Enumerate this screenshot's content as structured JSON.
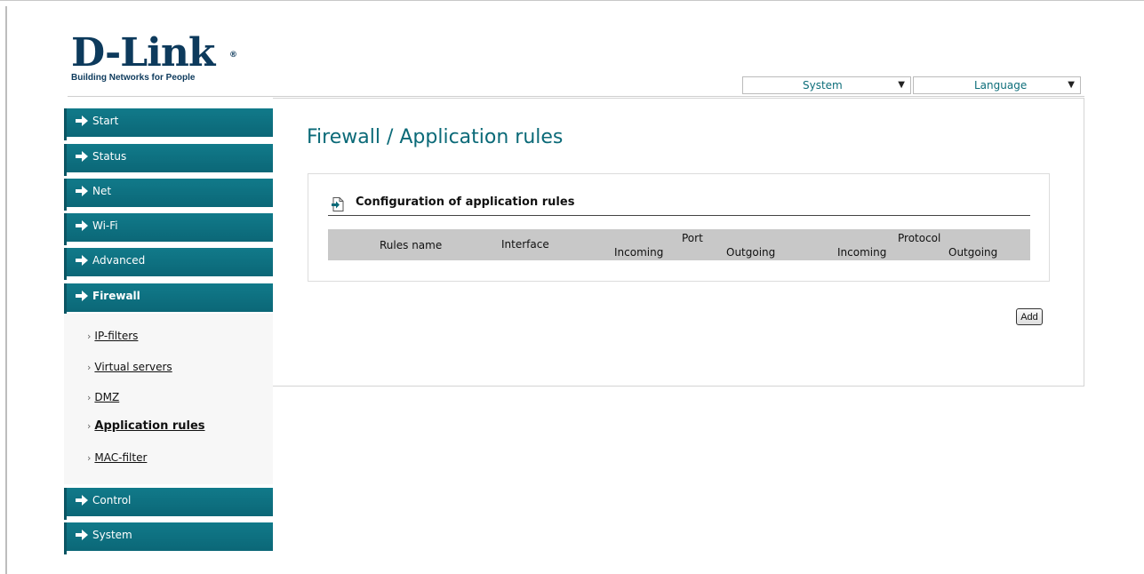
{
  "brand": {
    "logo_text": "D-Link",
    "logo_reg": "®",
    "tagline": "Building Networks for People"
  },
  "top_selects": {
    "system": {
      "value": "System",
      "arrow_icon": "dropdown-arrow"
    },
    "language": {
      "value": "Language",
      "arrow_icon": "dropdown-arrow"
    }
  },
  "sidebar": {
    "items": [
      {
        "label": "Start"
      },
      {
        "label": "Status"
      },
      {
        "label": "Net"
      },
      {
        "label": "Wi-Fi"
      },
      {
        "label": "Advanced"
      },
      {
        "label": "Firewall",
        "active": true
      },
      {
        "label": "Control"
      },
      {
        "label": "System"
      }
    ],
    "submenu": [
      {
        "label": "IP-filters"
      },
      {
        "label": "Virtual servers"
      },
      {
        "label": "DMZ"
      },
      {
        "label": "Application rules",
        "current": true
      },
      {
        "label": "MAC-filter"
      }
    ],
    "bullet": "›"
  },
  "page": {
    "title": "Firewall / Application rules",
    "section_title": "Configuration of application rules",
    "add_label": "Add"
  },
  "table": {
    "headers": {
      "rules_name": "Rules name",
      "interface": "Interface",
      "port": "Port",
      "port_incoming": "Incoming",
      "port_outgoing": "Outgoing",
      "protocol": "Protocol",
      "protocol_incoming": "Incoming",
      "protocol_outgoing": "Outgoing"
    },
    "rows": []
  },
  "colors": {
    "nav_bg": "#0b6777",
    "title": "#0b6a78",
    "table_header_bg": "#c8c8c8"
  }
}
